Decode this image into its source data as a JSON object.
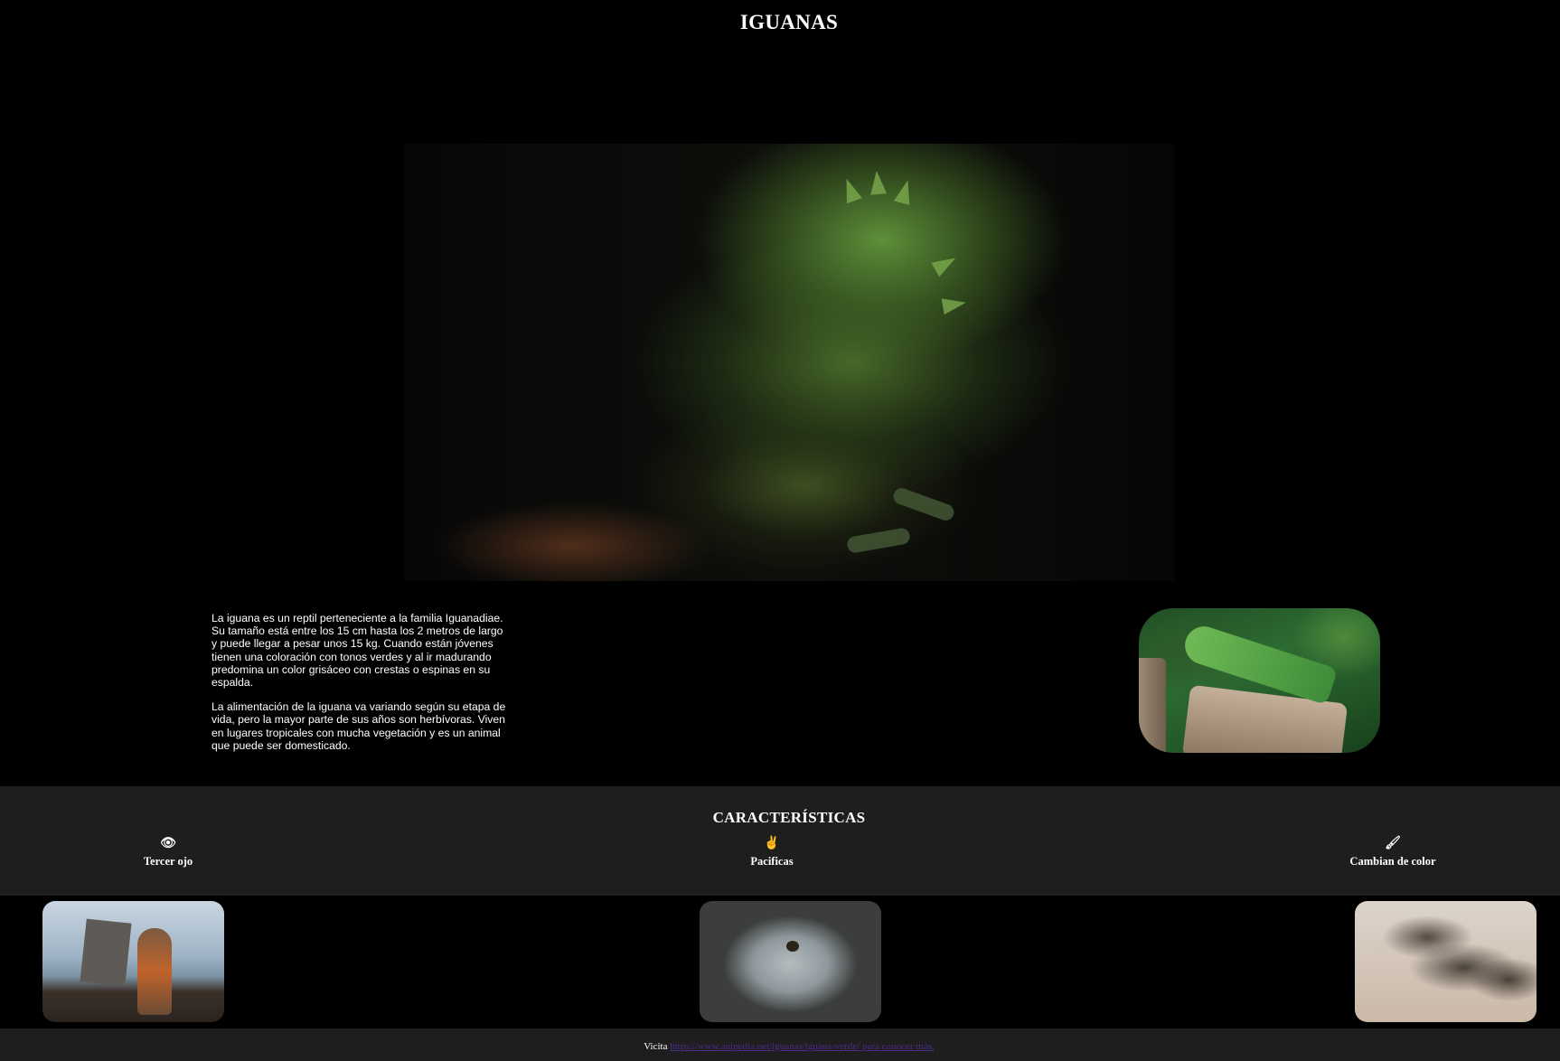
{
  "header": {
    "title": "IGUANAS"
  },
  "intro": {
    "paragraphs": [
      "La iguana es un reptil perteneciente a la familia Iguanadiae. Su tamaño está entre los 15 cm hasta los 2 metros de largo y puede llegar a pesar unos 15 kg. Cuando están jóvenes tienen una coloración con tonos verdes y al ir madurando predomina un color grisáceo con crestas o espinas en su espalda.",
      "La alimentación de la iguana va variando según su etapa de vida, pero la mayor parte de sus años son herbívoras. Viven en lugares tropicales con mucha vegetación y es un animal que puede ser domesticado."
    ]
  },
  "features": {
    "title": "CARACTERÍSTICAS",
    "items": [
      {
        "icon": "eye-icon",
        "glyph": "👁",
        "label": "Tercer ojo"
      },
      {
        "icon": "peace-hand-icon",
        "glyph": "✌",
        "label": "Pacificas"
      },
      {
        "icon": "paintbrush-icon",
        "glyph": "🖌",
        "label": "Cambian de color"
      }
    ]
  },
  "footer": {
    "prefix": "Vicita",
    "link_text": "https://www.anipedia.net/iguanas/iguana-verde/ para conocer más."
  },
  "colors": {
    "background": "#000000",
    "band": "#1e1e1e",
    "link": "#4b2b8c"
  }
}
